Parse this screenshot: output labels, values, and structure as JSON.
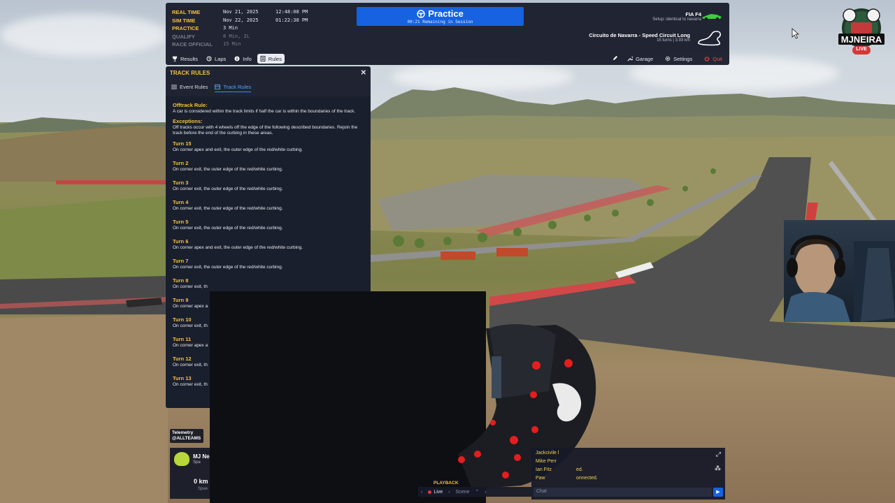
{
  "session": {
    "rows": [
      {
        "key": "Real Time",
        "v1": "Nov 21, 2025",
        "v2": "12:48:08 PM",
        "dim": false
      },
      {
        "key": "Sim Time",
        "v1": "Nov 22, 2025",
        "v2": "01:22:38 PM",
        "dim": false
      },
      {
        "key": "PRACTICE",
        "v1": "3 Min",
        "v2": "",
        "dim": false
      },
      {
        "key": "QUALIFY",
        "v1": "8 Min, 2L",
        "v2": "",
        "dim": true
      },
      {
        "key": "RACE OFFICIAL",
        "v1": "15 Min",
        "v2": "",
        "dim": true
      }
    ]
  },
  "banner": {
    "title": "Practice",
    "subtitle": "00:21 Remaining in Session",
    "color": "#1662e0"
  },
  "car": {
    "name": "FIA F4",
    "setup": "Setup: identical to navarra"
  },
  "track": {
    "name": "Circuito de Navarra - Speed Circuit Long",
    "meta": "15 turns  |  3.93 km"
  },
  "tabs": [
    {
      "label": "Results",
      "icon": "trophy-icon",
      "active": false
    },
    {
      "label": "Laps",
      "icon": "history-icon",
      "active": false
    },
    {
      "label": "Info",
      "icon": "info-icon",
      "active": false
    },
    {
      "label": "Rules",
      "icon": "rules-icon",
      "active": true
    }
  ],
  "actions": {
    "edit": "",
    "garage": "Garage",
    "settings": "Settings",
    "quit": "Quit"
  },
  "rules": {
    "title": "TRACK RULES",
    "tabs": [
      {
        "label": "Event Rules",
        "active": false
      },
      {
        "label": "Track Rules",
        "active": true
      }
    ],
    "offtrack_title": "Offtrack Rule:",
    "offtrack_text": "A car is considered within the track limits if half the car is within the boundaries of the track.",
    "exceptions_title": "Exceptions:",
    "exceptions_text": "Off tracks occur with 4 wheels off the edge of the following described boundaries. Rejoin the track before the end of the curbing in these areas.",
    "turns": [
      {
        "title": "Turn 15",
        "text": "On corner apex and exit, the outer edge of the red/white curbing."
      },
      {
        "title": "Turn 2",
        "text": "On corner exit, the outer edge of the red/white curbing."
      },
      {
        "title": "Turn 3",
        "text": "On corner exit, the outer edge of the red/white curbing."
      },
      {
        "title": "Turn 4",
        "text": "On corner exit, the outer edge of the red/white curbing."
      },
      {
        "title": "Turn 5",
        "text": "On corner exit, the outer edge of the red/white curbing."
      },
      {
        "title": "Turn 6",
        "text": "On corner apex and exit, the outer edge of the red/white curbing."
      },
      {
        "title": "Turn 7",
        "text": "On corner exit, the outer edge of the red/white curbing."
      },
      {
        "title": "Turn 8",
        "text": "On corner exit, th"
      },
      {
        "title": "Turn 9",
        "text": "On corner apex a"
      },
      {
        "title": "Turn 10",
        "text": "On corner exit, th"
      },
      {
        "title": "Turn 11",
        "text": "On corner apex a"
      },
      {
        "title": "Turn 12",
        "text": "On corner exit, th"
      },
      {
        "title": "Turn 13",
        "text": "On corner exit, th"
      }
    ]
  },
  "overlay": {
    "logo_text": "MJNEIRA",
    "logo_sub": "LIVE",
    "telemetry_line1": "Telemetry",
    "telemetry_line2": "@ALLTEAMS"
  },
  "driver": {
    "name": "MJ Ne",
    "flag_text": "Spa",
    "speed": "0 km",
    "speed_label": "Spee"
  },
  "chat": {
    "lines": [
      "Jackcivile l",
      "Mike Perr",
      "Ian Fitz",
      "Paw"
    ],
    "line_suffixes": [
      "",
      "",
      "ed.",
      "onnected."
    ],
    "placeholder": "Chat"
  },
  "playback": {
    "label": "PLAYBACK",
    "live": "Live",
    "scene": "Scene"
  }
}
